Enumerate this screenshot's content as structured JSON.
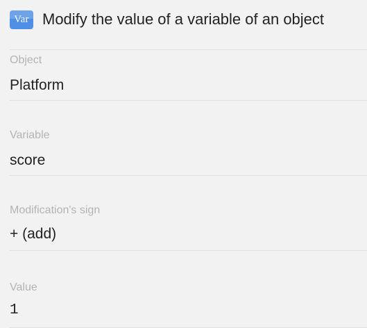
{
  "header": {
    "icon": "Var",
    "title": "Modify the value of a variable of an object"
  },
  "fields": [
    {
      "label": "Object",
      "value": "Platform"
    },
    {
      "label": "Variable",
      "value": "score"
    },
    {
      "label": "Modification's sign",
      "value": "+ (add)"
    },
    {
      "label": "Value",
      "value": "1"
    }
  ],
  "colors": {
    "background": "#f2f2f2",
    "icon": "#4f8fe6",
    "label": "#b3b3b3",
    "text": "#222222"
  }
}
